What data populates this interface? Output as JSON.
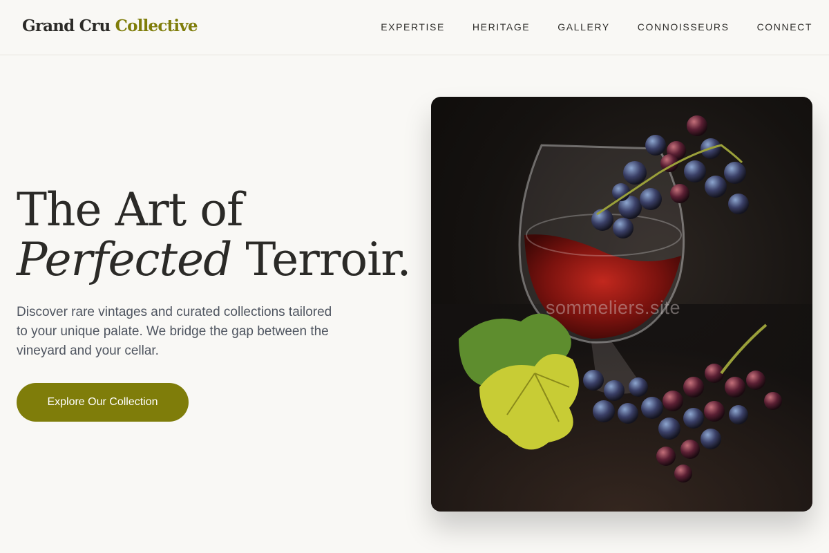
{
  "brand": {
    "name_part1": "Grand Cru",
    "name_part2": "Collective",
    "accent_color": "#7f7d0a"
  },
  "nav": {
    "items": [
      {
        "label": "EXPERTISE"
      },
      {
        "label": "HERITAGE"
      },
      {
        "label": "GALLERY"
      },
      {
        "label": "CONNOISSEURS"
      },
      {
        "label": "CONNECT"
      }
    ]
  },
  "hero": {
    "title_line1": "The Art of",
    "title_italic": "Perfected",
    "title_rest": "Terroir.",
    "subtitle": "Discover rare vintages and curated collections tailored to your unique palate. We bridge the gap between the vineyard and your cellar.",
    "cta_label": "Explore Our Collection"
  },
  "image": {
    "icon": "wine-glass-grapes-photo",
    "watermark": "sommeliers.site"
  }
}
